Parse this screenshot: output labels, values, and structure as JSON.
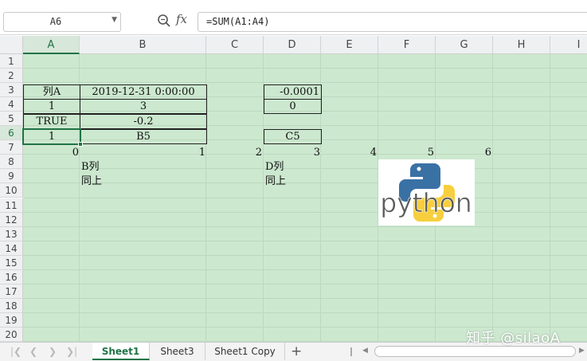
{
  "formula_bar": {
    "name_box": "A6",
    "fx_label": "fx",
    "formula": "=SUM(A1:A4)"
  },
  "columns": [
    "A",
    "B",
    "C",
    "D",
    "E",
    "F",
    "G",
    "H",
    "I"
  ],
  "active_column": "A",
  "rows": [
    "1",
    "2",
    "3",
    "4",
    "5",
    "6",
    "7",
    "8",
    "9",
    "10",
    "11",
    "12",
    "13",
    "14",
    "15",
    "16",
    "17",
    "18",
    "19",
    "20"
  ],
  "active_row": "6",
  "cells": {
    "A3": "列A",
    "B3": "2019-12-31 0:00:00",
    "D3": "-0.0001",
    "A4": "1",
    "B4": "3",
    "D4": "0",
    "A5": "TRUE",
    "B5": "-0.2",
    "A6": "1",
    "B6": "B5",
    "D6": "C5",
    "A7": "0",
    "B7": "1",
    "C7": "2",
    "D7": "3",
    "E7": "4",
    "F7": "5",
    "G7": "6",
    "B8": "B列",
    "D8": "D列",
    "B9": "同上",
    "D9": "同上"
  },
  "image": {
    "text": "python",
    "colors": {
      "blue": "#3a71a5",
      "yellow": "#f7cf3e",
      "text": "#5a5a5a"
    }
  },
  "sheet_tabs": [
    {
      "label": "Sheet1",
      "active": true
    },
    {
      "label": "Sheet3",
      "active": false
    },
    {
      "label": "Sheet1 Copy",
      "active": false
    }
  ],
  "watermark": "知乎 @silaoA",
  "colors": {
    "accent": "#217346",
    "cell_background": "#cce8cf",
    "header_background": "#eef0f2"
  }
}
